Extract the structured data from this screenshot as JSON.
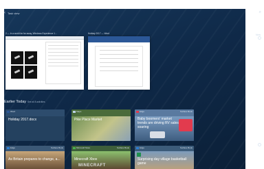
{
  "top_bar": {
    "back_label": "Task view"
  },
  "windows": [
    {
      "title": "2 — In a world far far away, Windows Experience 1…",
      "app": "Photos"
    },
    {
      "title": "Holiday 2017 — Word",
      "app": "Word"
    }
  ],
  "side": {
    "label": "Now"
  },
  "timeline": {
    "section_title": "Earlier Today",
    "section_subtitle": "See all 8 activities",
    "cards": [
      {
        "app": "Word",
        "source": "",
        "title": "Holiday 2017.docx"
      },
      {
        "app": "Maps",
        "source": "",
        "title": "Pike Place Market"
      },
      {
        "app": "Edge",
        "source": "Surface Book",
        "title": "Baby boomers' market trends are driving RV sales soaring"
      },
      {
        "app": "Edge",
        "source": "Surface Book",
        "title": "As Britain prepares to change, a..."
      },
      {
        "app": "Microsoft Store",
        "source": "Surface Book",
        "title": "Minecraft Xbox",
        "art_text": "MINECRAFT"
      },
      {
        "app": "Edge",
        "source": "Surface Book",
        "title": "Surprising day village basketball game"
      }
    ]
  },
  "colors": {
    "background": "#0f2948",
    "accent": "#2b5797",
    "red_thumb": "#e23b4e"
  }
}
